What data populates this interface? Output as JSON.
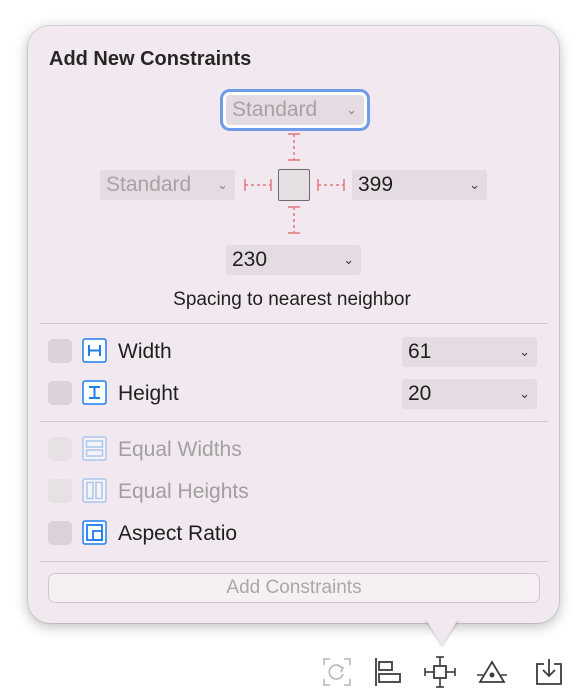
{
  "popover": {
    "title": "Add New Constraints",
    "spacing": {
      "top": "Standard",
      "leading": "Standard",
      "trailing": "399",
      "bottom": "230",
      "hint": "Spacing to nearest neighbor"
    },
    "size": {
      "width_label": "Width",
      "width_value": "61",
      "height_label": "Height",
      "height_value": "20"
    },
    "options": {
      "equal_widths": "Equal Widths",
      "equal_heights": "Equal Heights",
      "aspect_ratio": "Aspect Ratio"
    },
    "add_button": "Add Constraints",
    "chevron": "⌄"
  },
  "colors": {
    "accent": "#1d7ef0",
    "focus_ring": "#6f9ce8",
    "constraint_line": "#e0787c",
    "panel": "#f1e9ef"
  },
  "toolbar": {
    "icons": [
      "update-frames-icon",
      "align-icon",
      "add-constraints-icon",
      "resolve-issues-icon",
      "embed-in-icon"
    ]
  }
}
